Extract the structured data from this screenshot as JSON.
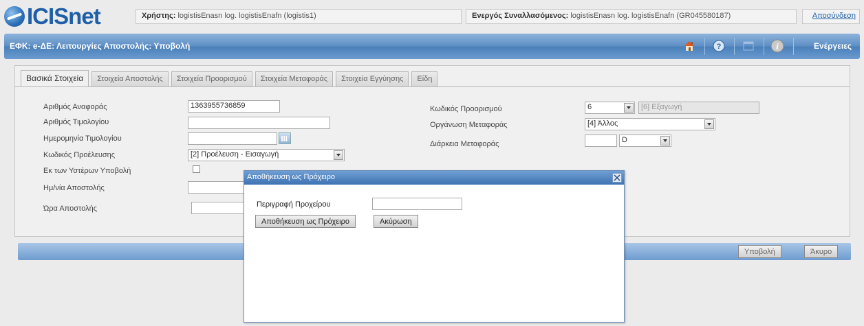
{
  "app": {
    "logo": "ICISnet"
  },
  "header": {
    "user_label": "Χρήστης:",
    "user_value": "logistisEnasn log. logistisEnafn (logistis1)",
    "trader_label": "Ενεργός Συναλλασόμενος:",
    "trader_value": "logistisEnasn log. logistisEnafn (GR045580187)",
    "logout": "Αποσύνδεση"
  },
  "titlebar": {
    "title": "ΕΦΚ: e-ΔΕ: Λειτουργίες Αποστολής: Υποβολή",
    "icons": [
      "home-icon",
      "help-icon",
      "window-icon",
      "info-icon"
    ],
    "actions": "Ενέργειες"
  },
  "tabs": [
    {
      "label": "Βασικά Στοιχεία",
      "active": true
    },
    {
      "label": "Στοιχεία Αποστολής"
    },
    {
      "label": "Στοιχεία Προορισμού"
    },
    {
      "label": "Στοιχεία Μεταφοράς"
    },
    {
      "label": "Στοιχεία Εγγύησης"
    },
    {
      "label": "Είδη"
    }
  ],
  "form": {
    "ref_label": "Αριθμός Αναφοράς",
    "ref_value": "1363955736859",
    "invoice_label": "Αριθμός Τιμολογίου",
    "invoice_value": "",
    "invoice_date_label": "Ημερομηνία Τιμολογίου",
    "invoice_date_value": "",
    "origin_label": "Κωδικός Προέλευσης",
    "origin_value": "[2] Προέλευση - Εισαγωγή",
    "deferred_label": "Εκ των Υστέρων Υποβολή",
    "dispatch_date_label": "Ημ/νία Αποστολής",
    "dispatch_time_label": "Ώρα Αποστολής",
    "dest_code_label": "Κωδικός Προορισμού",
    "dest_code_value": "6",
    "dest_code_desc": "[6] Εξαγωγή",
    "transport_org_label": "Οργάνωση Μεταφοράς",
    "transport_org_value": "[4] Άλλος",
    "duration_label": "Διάρκεια Μεταφοράς",
    "duration_value": "",
    "duration_unit": "D"
  },
  "actionbar": {
    "submit": "Υποβολή",
    "cancel": "Άκυρο"
  },
  "modal": {
    "title": "Αποθήκευση ως Πρόχειρο",
    "desc_label": "Περιγραφή Προχείρου",
    "desc_value": "",
    "save_button": "Αποθήκευση ως Πρόχειρο",
    "cancel_button": "Ακύρωση"
  }
}
